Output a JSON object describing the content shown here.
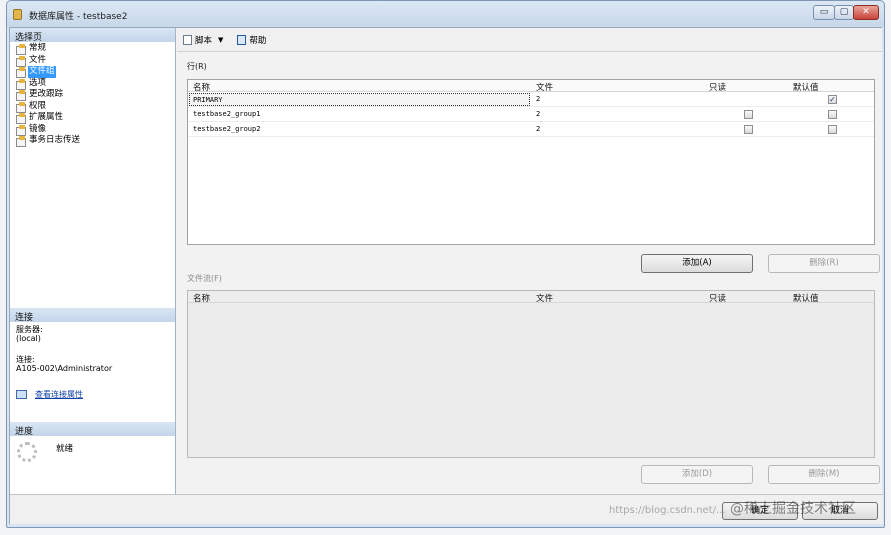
{
  "window": {
    "title": "数据库属性 - testbase2",
    "min_label": "▭",
    "max_label": "▢",
    "close_label": "✕"
  },
  "left": {
    "select_page_header": "选择页",
    "pages": [
      {
        "label": "常规"
      },
      {
        "label": "文件"
      },
      {
        "label": "文件组"
      },
      {
        "label": "选项"
      },
      {
        "label": "更改跟踪"
      },
      {
        "label": "权限"
      },
      {
        "label": "扩展属性"
      },
      {
        "label": "镜像"
      },
      {
        "label": "事务日志传送"
      }
    ],
    "connection_header": "连接",
    "server_label": "服务器:",
    "server_value": "(local)",
    "connection_label": "连接:",
    "connection_value": "A105-002\\Administrator",
    "view_conn_props": "查看连接属性",
    "progress_header": "进度",
    "progress_status": "就绪"
  },
  "toolbar": {
    "script_label": "脚本",
    "help_label": "帮助"
  },
  "rows_section": {
    "label": "行(R)",
    "columns": [
      "名称",
      "文件",
      "只读",
      "默认值"
    ],
    "rows": [
      {
        "name": "PRIMARY",
        "files": "2",
        "readonly": false,
        "default": true
      },
      {
        "name": "testbase2_group1",
        "files": "2",
        "readonly": false,
        "default": false
      },
      {
        "name": "testbase2_group2",
        "files": "2",
        "readonly": false,
        "default": false
      }
    ],
    "add_label": "添加(A)",
    "remove_label": "删除(R)"
  },
  "filestream_section": {
    "label": "文件流(F)",
    "columns": [
      "名称",
      "文件",
      "只读",
      "默认值"
    ],
    "add_label": "添加(D)",
    "remove_label": "删除(M)"
  },
  "footer": {
    "ok_label": "确定",
    "cancel_label": "取消"
  },
  "watermark": {
    "text": "@稀土掘金技术社区",
    "sub": "https://blog.csdn.net/..."
  },
  "colors": {
    "selection": "#3399ff",
    "link": "#0b3fa8"
  }
}
